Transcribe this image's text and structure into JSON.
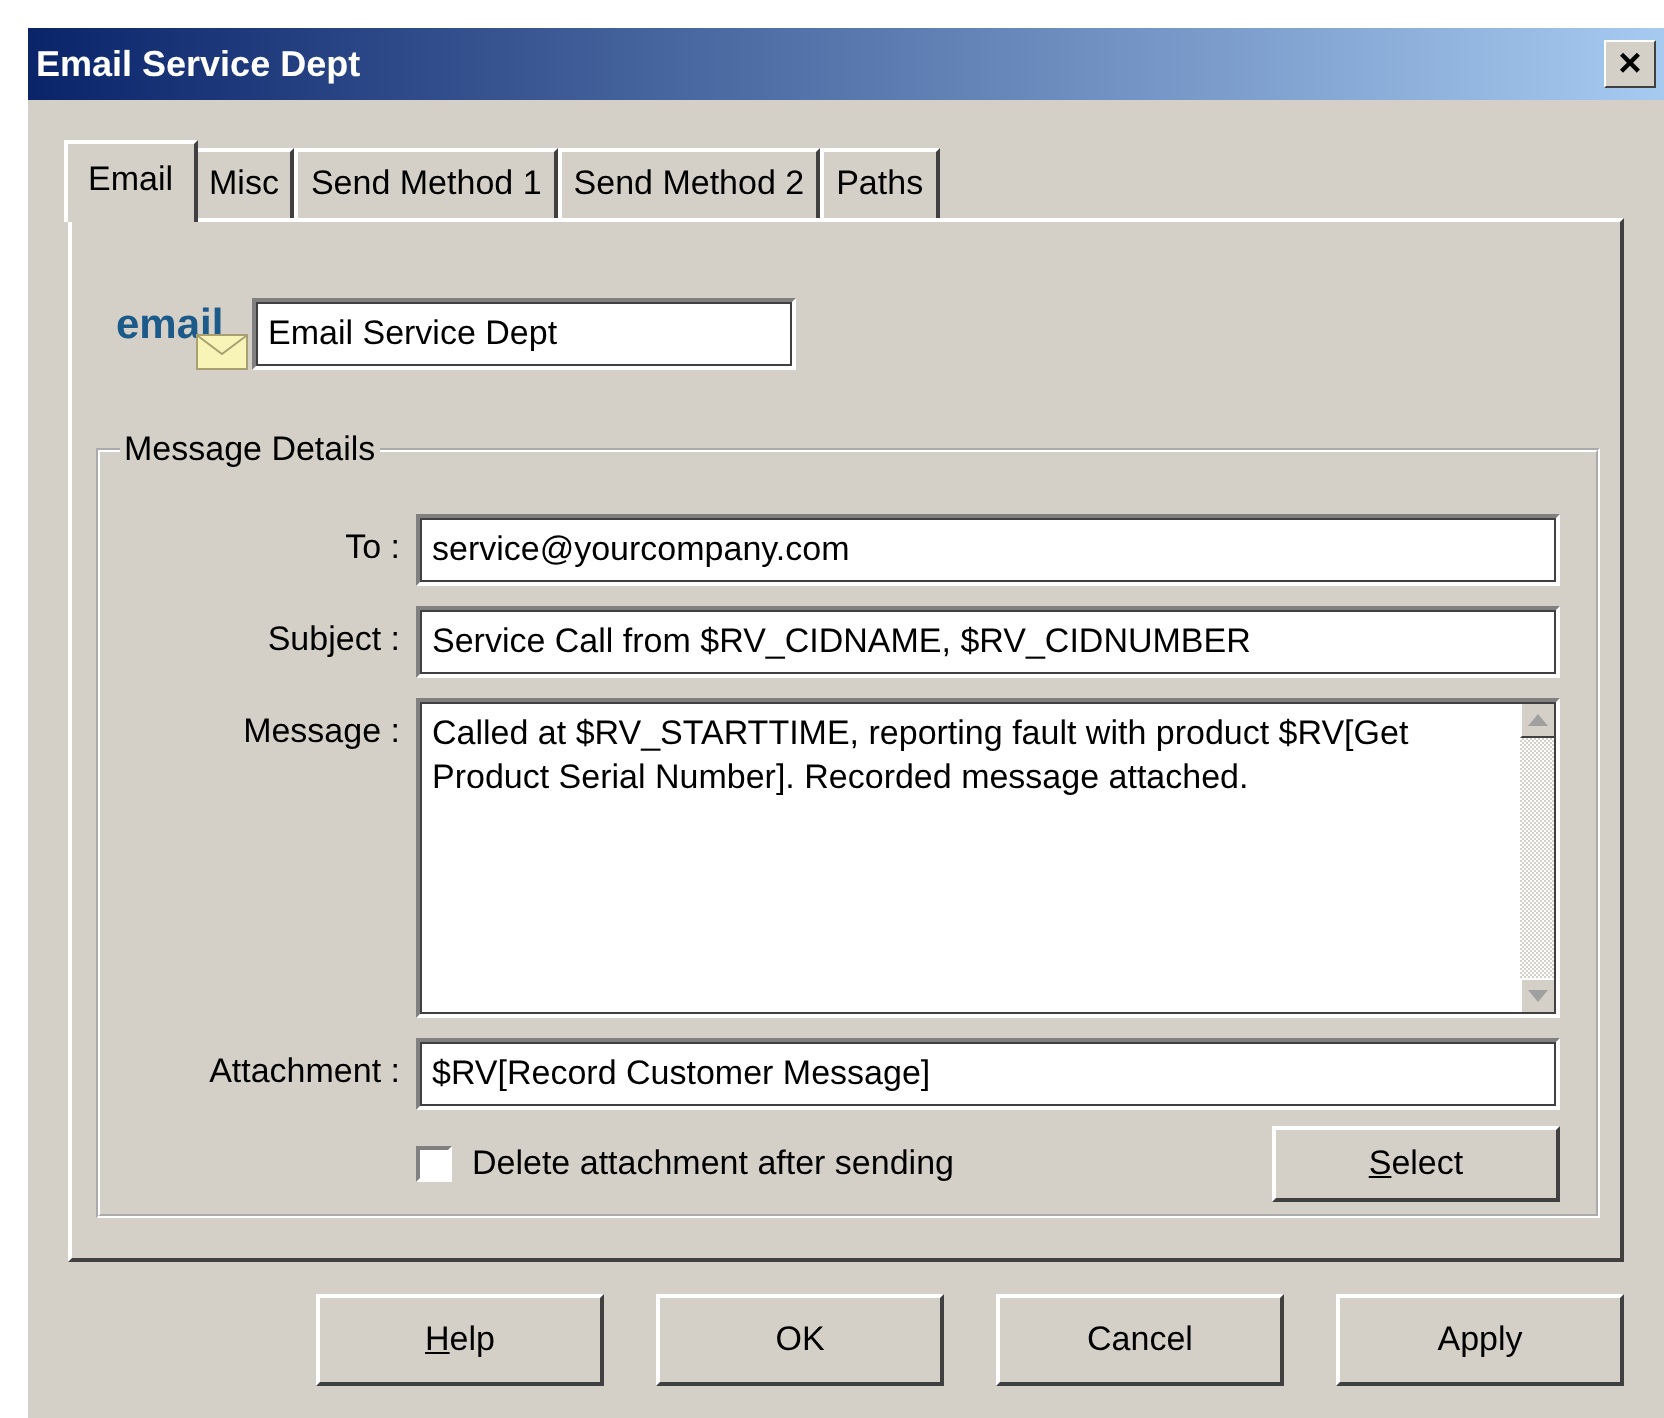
{
  "window": {
    "title": "Email Service Dept",
    "close": "×"
  },
  "tabs": [
    {
      "label": "Email",
      "selected": true
    },
    {
      "label": "Misc",
      "selected": false
    },
    {
      "label": "Send Method 1",
      "selected": false
    },
    {
      "label": "Send Method 2",
      "selected": false
    },
    {
      "label": "Paths",
      "selected": false
    }
  ],
  "logo": "email",
  "name_field": {
    "value": "Email Service Dept"
  },
  "group": {
    "title": "Message Details",
    "fields": [
      {
        "label": "To :",
        "value": "service@yourcompany.com",
        "kind": "line"
      },
      {
        "label": "Subject :",
        "value": "Service Call from $RV_CIDNAME, $RV_CIDNUMBER",
        "kind": "line"
      },
      {
        "label": "Message :",
        "value": "Called at $RV_STARTTIME, reporting fault with product $RV[Get Product Serial Number]. Recorded message attached.",
        "kind": "multiline"
      },
      {
        "label": "Attachment :",
        "value": "$RV[Record Customer Message]",
        "kind": "line"
      }
    ],
    "checkbox": {
      "label": "Delete attachment after sending",
      "checked": false
    },
    "select_button": {
      "label": "Select",
      "underline_first": true
    }
  },
  "buttons": [
    {
      "label": "Help",
      "underline_first": true
    },
    {
      "label": "OK",
      "underline_first": false
    },
    {
      "label": "Cancel",
      "underline_first": false
    },
    {
      "label": "Apply",
      "underline_first": false
    }
  ]
}
